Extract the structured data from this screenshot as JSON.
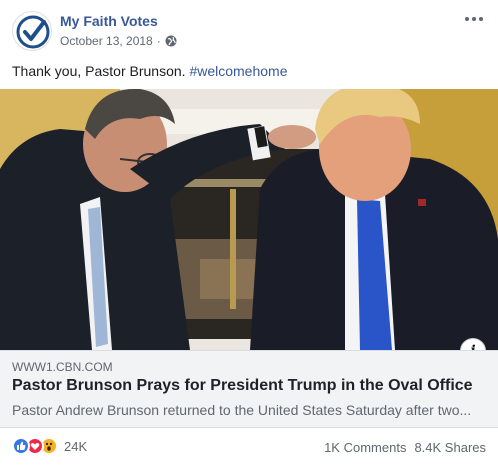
{
  "header": {
    "page_name": "My Faith Votes",
    "date": "October 13, 2018",
    "separator": "·",
    "privacy_icon": "globe-icon",
    "more_icon": "more-options-icon"
  },
  "post": {
    "text": "Thank you, Pastor Brunson. ",
    "hashtag": "#welcomehome"
  },
  "link_preview": {
    "domain": "WWW1.CBN.COM",
    "title": "Pastor Brunson Prays for President Trump in the Oval Office",
    "description": "Pastor Andrew Brunson returned to the United States Saturday after two...",
    "info_label": "i"
  },
  "footer": {
    "reaction_icons": [
      "like-icon",
      "love-icon",
      "wow-icon"
    ],
    "reaction_count": "24K",
    "comments": "1K Comments",
    "shares": "8.4K Shares"
  },
  "colors": {
    "link_blue": "#385898",
    "secondary_text": "#606770",
    "preview_bg": "#f2f3f5"
  }
}
